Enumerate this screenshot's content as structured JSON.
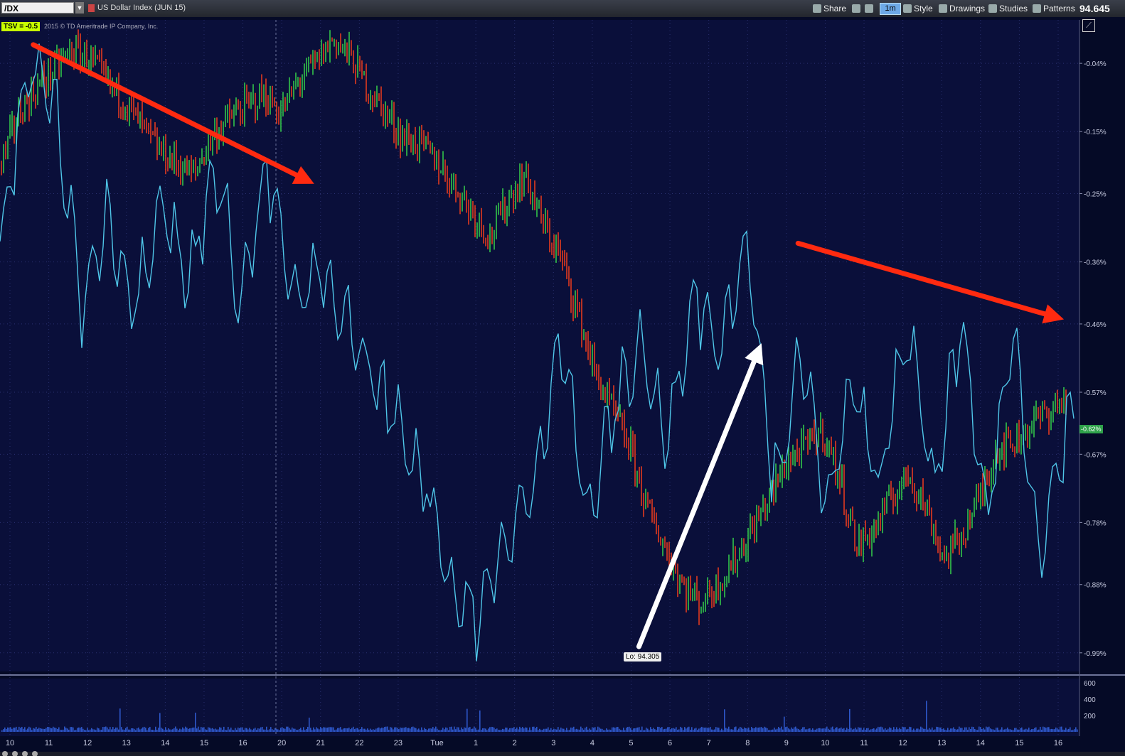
{
  "toolbar": {
    "symbol": "/DX",
    "description": "US Dollar Index (JUN 15)",
    "share_label": "Share",
    "timeframe_label": "1m",
    "style_label": "Style",
    "drawings_label": "Drawings",
    "studies_label": "Studies",
    "patterns_label": "Patterns",
    "last_price": "94.645"
  },
  "study_badge": "TSV = -0.5",
  "copyright": "2015 © TD Ameritrade IP Company, Inc.",
  "low_label": "Lo: 94.305",
  "price_tag": "-0.62%",
  "colors": {
    "background": "#0a0f3a",
    "up_bar": "#33c44a",
    "down_bar": "#e33a1e",
    "indicator": "#4fc6e8",
    "volume": "#2d56c8",
    "red_arrow": "#ff2a10",
    "white_arrow": "#ffffff"
  },
  "chart_data": {
    "type": "line",
    "x_tick_labels": [
      "10",
      "11",
      "12",
      "13",
      "14",
      "15",
      "16",
      "20",
      "21",
      "22",
      "23",
      "Tue",
      "1",
      "2",
      "3",
      "4",
      "5",
      "6",
      "7",
      "8",
      "9",
      "10",
      "11",
      "12",
      "13",
      "14",
      "15",
      "16"
    ],
    "y_axis": {
      "tick_labels": [
        "-0.04%",
        "-0.15%",
        "-0.25%",
        "-0.36%",
        "-0.46%",
        "-0.57%",
        "-0.67%",
        "-0.78%",
        "-0.88%",
        "-0.99%"
      ],
      "ylim": [
        -1.02,
        0.03
      ]
    },
    "volume_axis": {
      "tick_labels": [
        "600",
        "400",
        "200"
      ],
      "ylim": [
        0,
        650
      ]
    },
    "grid": true,
    "series": [
      {
        "kind": "candles",
        "values": [
          -0.2,
          -0.12,
          -0.08,
          -0.05,
          -0.02,
          -0.03,
          -0.07,
          -0.1,
          -0.14,
          -0.18,
          -0.2,
          -0.22,
          -0.16,
          -0.13,
          -0.11,
          -0.09,
          -0.12,
          -0.07,
          -0.04,
          0.0,
          -0.03,
          -0.08,
          -0.12,
          -0.16,
          -0.17,
          -0.2,
          -0.24,
          -0.28,
          -0.32,
          -0.26,
          -0.22,
          -0.3,
          -0.35,
          -0.44,
          -0.54,
          -0.6,
          -0.66,
          -0.76,
          -0.82,
          -0.88,
          -0.91,
          -0.88,
          -0.84,
          -0.79,
          -0.74,
          -0.68,
          -0.66,
          -0.63,
          -0.71,
          -0.82,
          -0.79,
          -0.74,
          -0.7,
          -0.76,
          -0.84,
          -0.8,
          -0.74,
          -0.66,
          -0.65,
          -0.62,
          -0.6,
          -0.58
        ]
      },
      {
        "kind": "indicator",
        "values": [
          -0.33,
          -0.05,
          -0.1,
          -0.43,
          -0.28,
          -0.43,
          -0.25,
          -0.4,
          -0.2,
          -0.42,
          -0.21,
          -0.43,
          -0.38,
          -0.46,
          -0.55,
          -0.63,
          -0.72,
          -0.9,
          -0.93,
          -0.8,
          -0.73,
          -0.46,
          -0.78,
          -0.6,
          -0.49,
          -0.66,
          -0.4,
          -0.5,
          -0.31,
          -0.72,
          -0.52,
          -0.74,
          -0.57,
          -0.72,
          -0.46,
          -0.73,
          -0.47,
          -0.77,
          -0.47,
          -0.83,
          -0.62
        ]
      }
    ],
    "annotations": [
      {
        "kind": "arrow",
        "color": "red",
        "from": [
          0.6,
          -0.01
        ],
        "to": [
          7.7,
          -0.23
        ]
      },
      {
        "kind": "arrow",
        "color": "white",
        "from": [
          16.2,
          -0.98
        ],
        "to": [
          19.3,
          -0.5
        ]
      },
      {
        "kind": "arrow",
        "color": "red",
        "from": [
          20.3,
          -0.33
        ],
        "to": [
          27.0,
          -0.45
        ]
      }
    ]
  }
}
